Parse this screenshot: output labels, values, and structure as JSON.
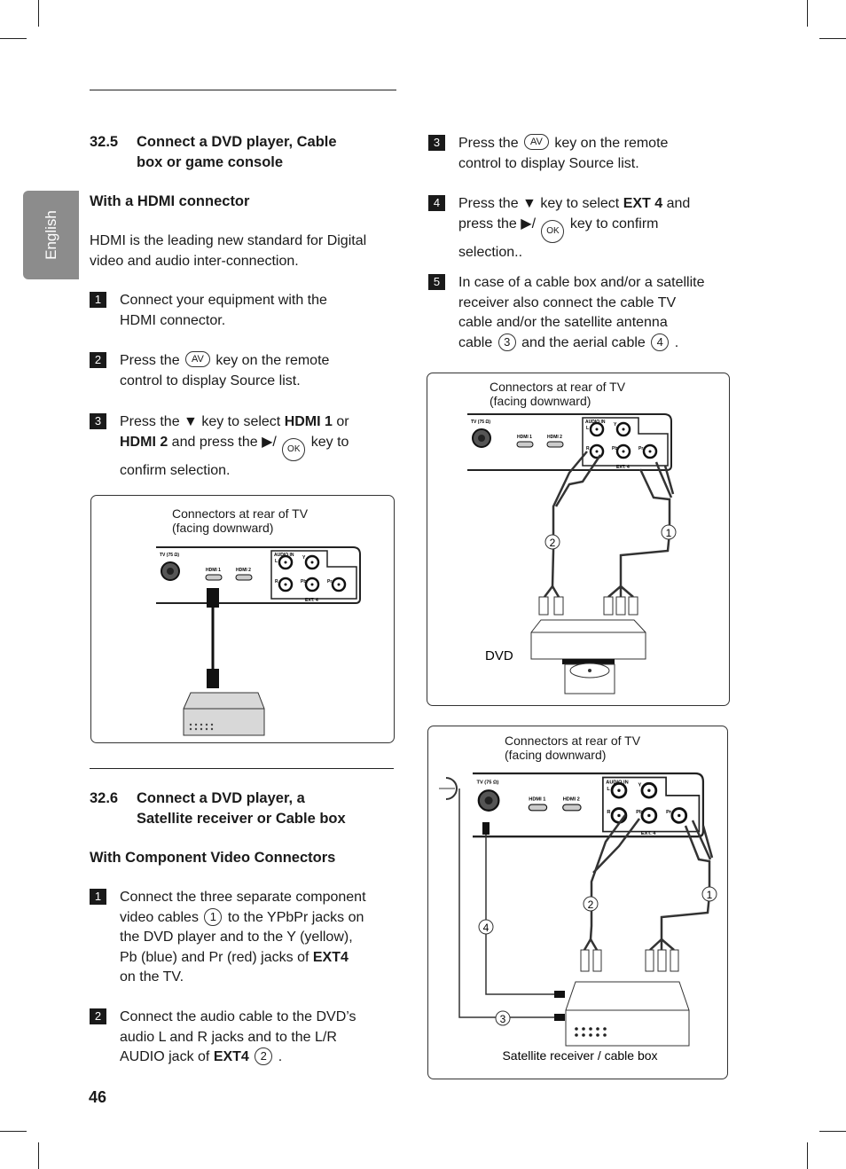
{
  "language_tab": "English",
  "page_number": "46",
  "section_325": {
    "number": "32.5",
    "title_line1": "Connect a DVD player, Cable",
    "title_line2": "box or game console",
    "subheading": "With a HDMI connector",
    "intro_line1": "HDMI is the leading new standard for Digital",
    "intro_line2": "video and audio inter-connection.",
    "steps": [
      {
        "n": "1",
        "segs": [
          {
            "t": "Connect your equipment with the"
          },
          {
            "br": true
          },
          {
            "t": "HDMI connector."
          }
        ]
      },
      {
        "n": "2",
        "segs": [
          {
            "t": "Press the "
          },
          {
            "key": "AV"
          },
          {
            "t": " key on the remote"
          },
          {
            "br": true
          },
          {
            "t": "control to display Source list."
          }
        ]
      },
      {
        "n": "3",
        "segs": [
          {
            "t": "Press the ▼ key to select "
          },
          {
            "t": "HDMI 1",
            "b": true
          },
          {
            "t": " or"
          },
          {
            "br": true
          },
          {
            "t": "HDMI 2",
            "b": true
          },
          {
            "t": " and press the ▶/ "
          },
          {
            "ok": "OK"
          },
          {
            "t": " key to"
          },
          {
            "br": true
          },
          {
            "t": "confirm selection."
          }
        ]
      }
    ]
  },
  "section_326": {
    "number": "32.6",
    "title_line1": "Connect a DVD player, a",
    "title_line2": "Satellite receiver or Cable box",
    "subheading": "With Component Video Connectors",
    "steps": [
      {
        "n": "1",
        "segs": [
          {
            "t": "Connect the three separate component"
          },
          {
            "br": true
          },
          {
            "t": "video cables "
          },
          {
            "circ": "1"
          },
          {
            "t": " to the YPbPr jacks on"
          },
          {
            "br": true
          },
          {
            "t": "the DVD player and to the Y (yellow),"
          },
          {
            "br": true
          },
          {
            "t": "Pb (blue) and Pr (red) jacks of "
          },
          {
            "t": "EXT4",
            "b": true
          },
          {
            "br": true
          },
          {
            "t": "on the TV."
          }
        ]
      },
      {
        "n": "2",
        "segs": [
          {
            "t": "Connect the audio cable to the DVD’s"
          },
          {
            "br": true
          },
          {
            "t": "audio L and R jacks and to the L/R"
          },
          {
            "br": true
          },
          {
            "t": "AUDIO jack of "
          },
          {
            "t": "EXT4",
            "b": true
          },
          {
            "t": " "
          },
          {
            "circ": "2"
          },
          {
            "t": " ."
          }
        ]
      },
      {
        "n": "3",
        "segs": [
          {
            "t": "Press the "
          },
          {
            "key": "AV"
          },
          {
            "t": " key on the remote"
          },
          {
            "br": true
          },
          {
            "t": "control to display Source list."
          }
        ]
      },
      {
        "n": "4",
        "segs": [
          {
            "t": "Press the ▼ key to select "
          },
          {
            "t": "EXT 4",
            "b": true
          },
          {
            "t": " and"
          },
          {
            "br": true
          },
          {
            "t": "press the ▶/ "
          },
          {
            "ok": "OK"
          },
          {
            "t": " key to confirm"
          },
          {
            "br": true
          },
          {
            "t": "selection.."
          }
        ]
      },
      {
        "n": "5",
        "segs": [
          {
            "t": "In case of a cable box and/or a satellite"
          },
          {
            "br": true
          },
          {
            "t": "receiver also connect the cable TV"
          },
          {
            "br": true
          },
          {
            "t": "cable and/or the satellite antenna"
          },
          {
            "br": true
          },
          {
            "t": "cable "
          },
          {
            "circ": "3"
          },
          {
            "t": " and the aerial cable "
          },
          {
            "circ": "4"
          },
          {
            "t": " ."
          }
        ]
      }
    ]
  },
  "panel": {
    "tv": "TV (75 Ω)",
    "hdmi1": "HDMI 1",
    "hdmi2": "HDMI 2",
    "audio_in": "AUDIO IN",
    "l": "L",
    "r": "R",
    "y": "Y",
    "pb": "Pb",
    "pr": "Pr",
    "ext": "EXT. 4"
  },
  "diagrams": {
    "hdmi": {
      "caption_line1": "Connectors at rear of TV",
      "caption_line2": "(facing downward)"
    },
    "dvd": {
      "caption_line1": "Connectors at rear of TV",
      "caption_line2": "(facing downward)",
      "device_label": "DVD",
      "cable1": "1",
      "cable2": "2"
    },
    "satellite": {
      "caption_line1": "Connectors at rear of TV",
      "caption_line2": "(facing downward)",
      "device_label": "Satellite receiver / cable box",
      "cable1": "1",
      "cable2": "2",
      "cable3": "3",
      "cable4": "4"
    }
  }
}
